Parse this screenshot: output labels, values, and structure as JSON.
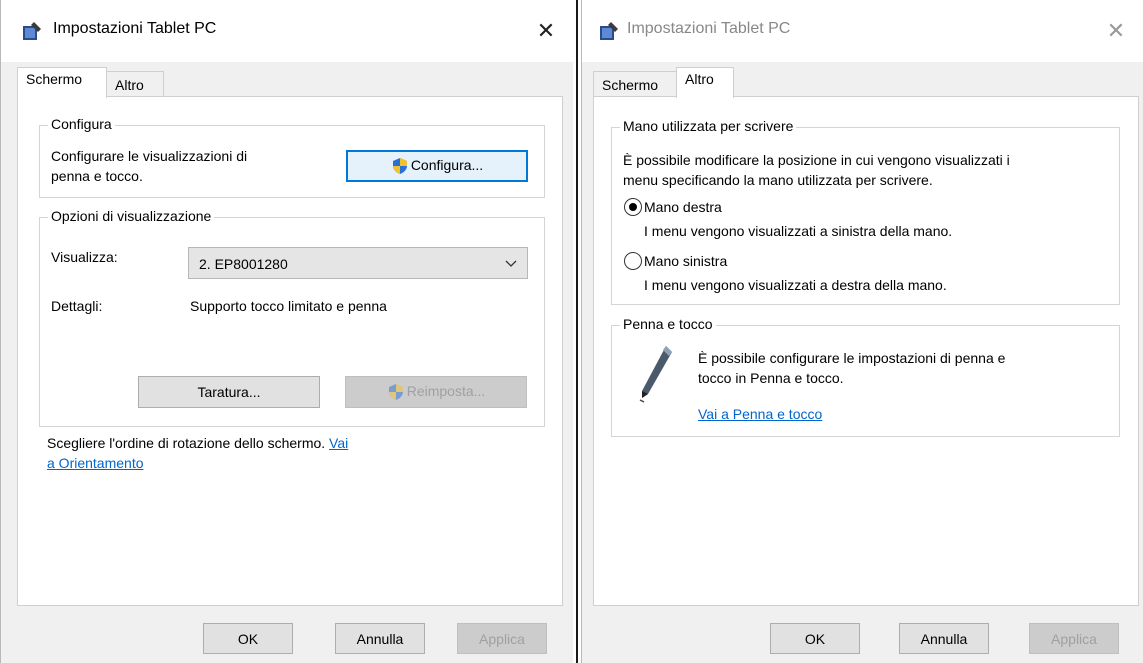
{
  "left_window": {
    "title": "Impostazioni Tablet PC",
    "tabs": [
      {
        "label": "Schermo",
        "active": true
      },
      {
        "label": "Altro",
        "active": false
      }
    ],
    "configura_group": {
      "legend": "Configura",
      "description_line1": "Configurare le visualizzazioni di",
      "description_line2": "penna e tocco.",
      "button_label": "Configura..."
    },
    "display_group": {
      "legend": "Opzioni di visualizzazione",
      "display_label": "Visualizza:",
      "display_value": "2. EP8001280",
      "details_label": "Dettagli:",
      "details_value": "Supporto tocco limitato e penna",
      "calibrate_button": "Taratura...",
      "reset_button": "Reimposta..."
    },
    "rotation_text": "Scegliere l'ordine di rotazione dello schermo.",
    "rotation_link_part1": "Vai",
    "rotation_link_part2": "a Orientamento",
    "buttons": {
      "ok": "OK",
      "cancel": "Annulla",
      "apply": "Applica"
    }
  },
  "right_window": {
    "title": "Impostazioni Tablet PC",
    "tabs": [
      {
        "label": "Schermo",
        "active": false
      },
      {
        "label": "Altro",
        "active": true
      }
    ],
    "hand_group": {
      "legend": "Mano utilizzata per scrivere",
      "description_line1": "È possibile modificare la posizione in cui vengono visualizzati i",
      "description_line2": "menu specificando la mano utilizzata per scrivere.",
      "right_hand_label": "Mano destra",
      "right_hand_desc": "I menu vengono visualizzati a sinistra della mano.",
      "left_hand_label": "Mano sinistra",
      "left_hand_desc": "I menu vengono visualizzati a destra della mano.",
      "selected": "right"
    },
    "pen_group": {
      "legend": "Penna e tocco",
      "description_line1": "È possibile configurare le impostazioni di penna e",
      "description_line2": "tocco in Penna e tocco.",
      "link": "Vai a Penna e tocco"
    },
    "buttons": {
      "ok": "OK",
      "cancel": "Annulla",
      "apply": "Applica"
    }
  },
  "icons": {
    "app": "tablet-pc-icon",
    "close": "close-icon",
    "shield": "uac-shield-icon",
    "dropdown": "chevron-down-icon",
    "pen": "pen-icon"
  },
  "colors": {
    "link": "#0066cc",
    "focus_border": "#0078d7",
    "window_bg": "#f0f0f0"
  }
}
